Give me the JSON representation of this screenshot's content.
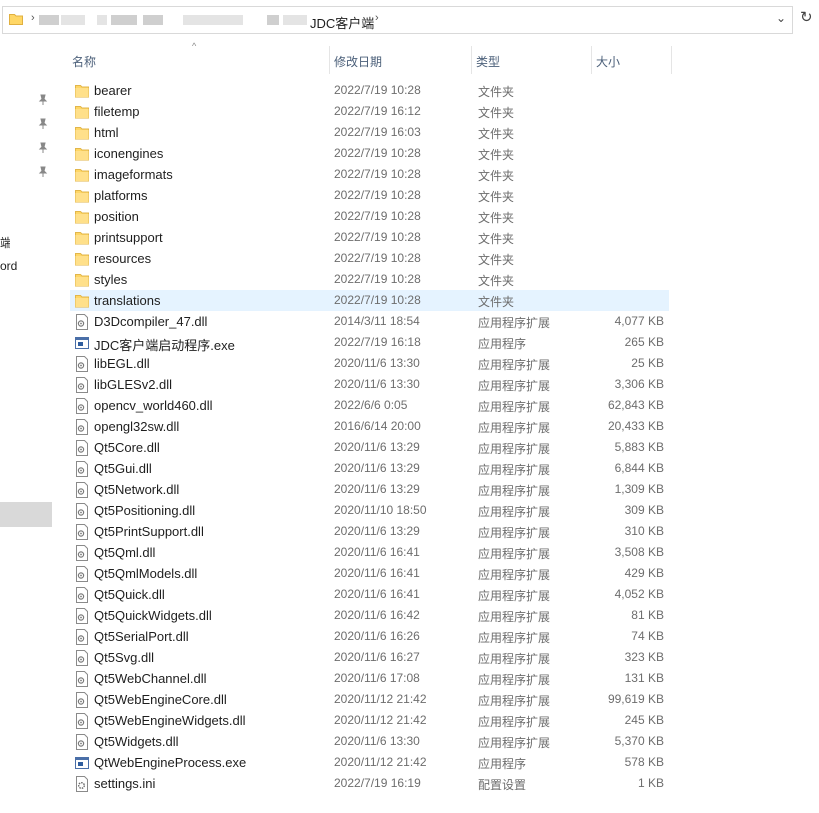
{
  "address_bar": {
    "current_folder": "JDC客户端",
    "separator": "›"
  },
  "refresh_glyph": "↻",
  "dropdown_glyph": "⌄",
  "nav_pane": {
    "partial_items": [
      "端",
      "ord"
    ]
  },
  "columns": {
    "name": "名称",
    "date": "修改日期",
    "type": "类型",
    "size": "大小"
  },
  "files": [
    {
      "name": "bearer",
      "date": "2022/7/19 10:28",
      "type": "文件夹",
      "size": "",
      "icon": "folder-icon"
    },
    {
      "name": "filetemp",
      "date": "2022/7/19 16:12",
      "type": "文件夹",
      "size": "",
      "icon": "folder-icon"
    },
    {
      "name": "html",
      "date": "2022/7/19 16:03",
      "type": "文件夹",
      "size": "",
      "icon": "folder-icon"
    },
    {
      "name": "iconengines",
      "date": "2022/7/19 10:28",
      "type": "文件夹",
      "size": "",
      "icon": "folder-icon"
    },
    {
      "name": "imageformats",
      "date": "2022/7/19 10:28",
      "type": "文件夹",
      "size": "",
      "icon": "folder-icon"
    },
    {
      "name": "platforms",
      "date": "2022/7/19 10:28",
      "type": "文件夹",
      "size": "",
      "icon": "folder-icon"
    },
    {
      "name": "position",
      "date": "2022/7/19 10:28",
      "type": "文件夹",
      "size": "",
      "icon": "folder-icon"
    },
    {
      "name": "printsupport",
      "date": "2022/7/19 10:28",
      "type": "文件夹",
      "size": "",
      "icon": "folder-icon"
    },
    {
      "name": "resources",
      "date": "2022/7/19 10:28",
      "type": "文件夹",
      "size": "",
      "icon": "folder-icon"
    },
    {
      "name": "styles",
      "date": "2022/7/19 10:28",
      "type": "文件夹",
      "size": "",
      "icon": "folder-icon"
    },
    {
      "name": "translations",
      "date": "2022/7/19 10:28",
      "type": "文件夹",
      "size": "",
      "icon": "folder-icon",
      "hover": true
    },
    {
      "name": "D3Dcompiler_47.dll",
      "date": "2014/3/11 18:54",
      "type": "应用程序扩展",
      "size": "4,077 KB",
      "icon": "dll-file-icon"
    },
    {
      "name": "JDC客户端启动程序.exe",
      "date": "2022/7/19 16:18",
      "type": "应用程序",
      "size": "265 KB",
      "icon": "exe-file-icon"
    },
    {
      "name": "libEGL.dll",
      "date": "2020/11/6 13:30",
      "type": "应用程序扩展",
      "size": "25 KB",
      "icon": "dll-file-icon"
    },
    {
      "name": "libGLESv2.dll",
      "date": "2020/11/6 13:30",
      "type": "应用程序扩展",
      "size": "3,306 KB",
      "icon": "dll-file-icon"
    },
    {
      "name": "opencv_world460.dll",
      "date": "2022/6/6 0:05",
      "type": "应用程序扩展",
      "size": "62,843 KB",
      "icon": "dll-file-icon"
    },
    {
      "name": "opengl32sw.dll",
      "date": "2016/6/14 20:00",
      "type": "应用程序扩展",
      "size": "20,433 KB",
      "icon": "dll-file-icon"
    },
    {
      "name": "Qt5Core.dll",
      "date": "2020/11/6 13:29",
      "type": "应用程序扩展",
      "size": "5,883 KB",
      "icon": "dll-file-icon"
    },
    {
      "name": "Qt5Gui.dll",
      "date": "2020/11/6 13:29",
      "type": "应用程序扩展",
      "size": "6,844 KB",
      "icon": "dll-file-icon"
    },
    {
      "name": "Qt5Network.dll",
      "date": "2020/11/6 13:29",
      "type": "应用程序扩展",
      "size": "1,309 KB",
      "icon": "dll-file-icon"
    },
    {
      "name": "Qt5Positioning.dll",
      "date": "2020/11/10 18:50",
      "type": "应用程序扩展",
      "size": "309 KB",
      "icon": "dll-file-icon"
    },
    {
      "name": "Qt5PrintSupport.dll",
      "date": "2020/11/6 13:29",
      "type": "应用程序扩展",
      "size": "310 KB",
      "icon": "dll-file-icon"
    },
    {
      "name": "Qt5Qml.dll",
      "date": "2020/11/6 16:41",
      "type": "应用程序扩展",
      "size": "3,508 KB",
      "icon": "dll-file-icon"
    },
    {
      "name": "Qt5QmlModels.dll",
      "date": "2020/11/6 16:41",
      "type": "应用程序扩展",
      "size": "429 KB",
      "icon": "dll-file-icon"
    },
    {
      "name": "Qt5Quick.dll",
      "date": "2020/11/6 16:41",
      "type": "应用程序扩展",
      "size": "4,052 KB",
      "icon": "dll-file-icon"
    },
    {
      "name": "Qt5QuickWidgets.dll",
      "date": "2020/11/6 16:42",
      "type": "应用程序扩展",
      "size": "81 KB",
      "icon": "dll-file-icon"
    },
    {
      "name": "Qt5SerialPort.dll",
      "date": "2020/11/6 16:26",
      "type": "应用程序扩展",
      "size": "74 KB",
      "icon": "dll-file-icon"
    },
    {
      "name": "Qt5Svg.dll",
      "date": "2020/11/6 16:27",
      "type": "应用程序扩展",
      "size": "323 KB",
      "icon": "dll-file-icon"
    },
    {
      "name": "Qt5WebChannel.dll",
      "date": "2020/11/6 17:08",
      "type": "应用程序扩展",
      "size": "131 KB",
      "icon": "dll-file-icon"
    },
    {
      "name": "Qt5WebEngineCore.dll",
      "date": "2020/11/12 21:42",
      "type": "应用程序扩展",
      "size": "99,619 KB",
      "icon": "dll-file-icon"
    },
    {
      "name": "Qt5WebEngineWidgets.dll",
      "date": "2020/11/12 21:42",
      "type": "应用程序扩展",
      "size": "245 KB",
      "icon": "dll-file-icon"
    },
    {
      "name": "Qt5Widgets.dll",
      "date": "2020/11/6 13:30",
      "type": "应用程序扩展",
      "size": "5,370 KB",
      "icon": "dll-file-icon"
    },
    {
      "name": "QtWebEngineProcess.exe",
      "date": "2020/11/12 21:42",
      "type": "应用程序",
      "size": "578 KB",
      "icon": "exe-file-icon"
    },
    {
      "name": "settings.ini",
      "date": "2022/7/19 16:19",
      "type": "配置设置",
      "size": "1 KB",
      "icon": "ini-file-icon"
    }
  ],
  "colors": {
    "hover_row": "#e5f3ff",
    "header_text": "#4c607a",
    "folder_yellow": "#ffd766",
    "nav_selected": "#d9d9d9"
  }
}
